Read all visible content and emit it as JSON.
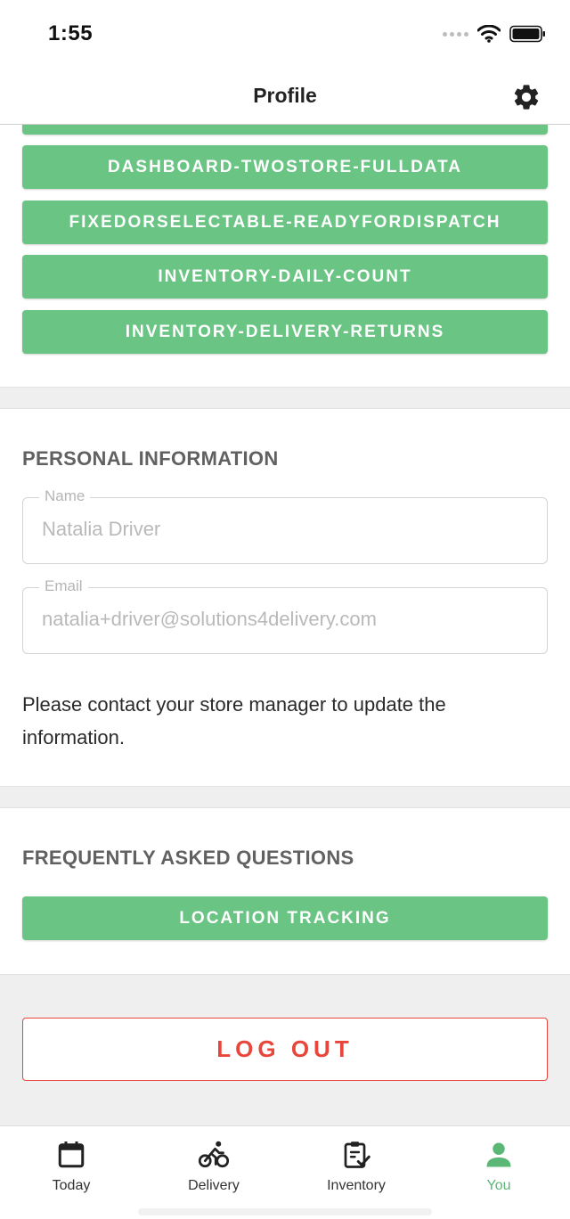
{
  "status_bar": {
    "time": "1:55"
  },
  "header": {
    "title": "Profile"
  },
  "store_buttons": [
    "DASHBOARD-TWOSTORE-FULLDATA",
    "FIXEDORSELECTABLE-READYFORDISPATCH",
    "INVENTORY-DAILY-COUNT",
    "INVENTORY-DELIVERY-RETURNS"
  ],
  "personal_info": {
    "title": "PERSONAL INFORMATION",
    "name_label": "Name",
    "name_value": "Natalia Driver",
    "email_label": "Email",
    "email_value": "natalia+driver@solutions4delivery.com",
    "note": "Please contact your store manager to update the information."
  },
  "faq": {
    "title": "FREQUENTLY ASKED QUESTIONS",
    "buttons": [
      "LOCATION TRACKING"
    ]
  },
  "logout_label": "LOG OUT",
  "tabs": [
    {
      "label": "Today",
      "icon": "calendar-icon"
    },
    {
      "label": "Delivery",
      "icon": "bicycle-icon"
    },
    {
      "label": "Inventory",
      "icon": "clipboard-check-icon"
    },
    {
      "label": "You",
      "icon": "person-icon",
      "active": true
    }
  ],
  "colors": {
    "accent": "#6ac484",
    "danger": "#e8463a",
    "active_tab": "#5ab775"
  }
}
